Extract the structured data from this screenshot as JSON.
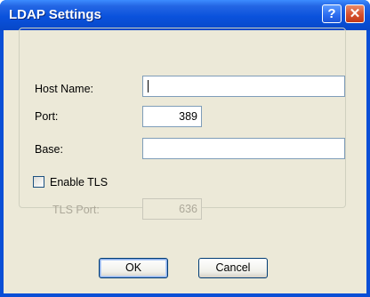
{
  "window": {
    "title": "LDAP Settings"
  },
  "titlebar": {
    "help_glyph": "?",
    "close_glyph": "✕"
  },
  "form": {
    "host_name": {
      "label": "Host Name:",
      "value": ""
    },
    "port": {
      "label": "Port:",
      "value": "389"
    },
    "base": {
      "label": "Base:",
      "value": ""
    },
    "enable_tls": {
      "label": "Enable TLS",
      "checked": false
    },
    "tls_port": {
      "label": "TLS Port:",
      "value": "636",
      "disabled": true
    }
  },
  "buttons": {
    "ok_label": "OK",
    "cancel_label": "Cancel"
  }
}
